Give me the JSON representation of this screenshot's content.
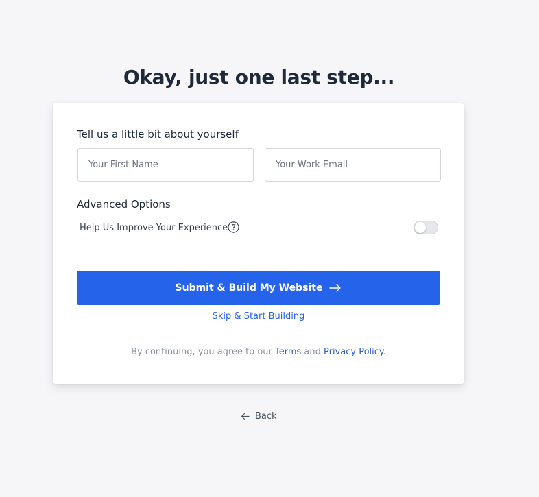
{
  "page": {
    "title": "Okay, just one last step..."
  },
  "form": {
    "section_label": "Tell us a little bit about yourself",
    "first_name": {
      "placeholder": "Your First Name",
      "value": ""
    },
    "work_email": {
      "placeholder": "Your Work Email",
      "value": ""
    },
    "advanced_label": "Advanced Options",
    "improve_toggle": {
      "label": "Help Us Improve Your Experience",
      "help_icon": "question-circle-icon",
      "enabled": false
    },
    "submit_label": "Submit & Build My Website",
    "submit_icon": "arrow-right-icon",
    "skip_label": "Skip & Start Building"
  },
  "legal": {
    "prefix": "By continuing, you agree to our ",
    "terms_label": "Terms",
    "conjunction": " and ",
    "privacy_label": "Privacy Policy",
    "suffix": "."
  },
  "navigation": {
    "back_label": "Back",
    "back_icon": "arrow-left-icon"
  },
  "colors": {
    "accent": "#2563eb",
    "background": "#f6f6f8",
    "card": "#ffffff",
    "heading": "#1e2939",
    "muted": "#8b93a1"
  }
}
